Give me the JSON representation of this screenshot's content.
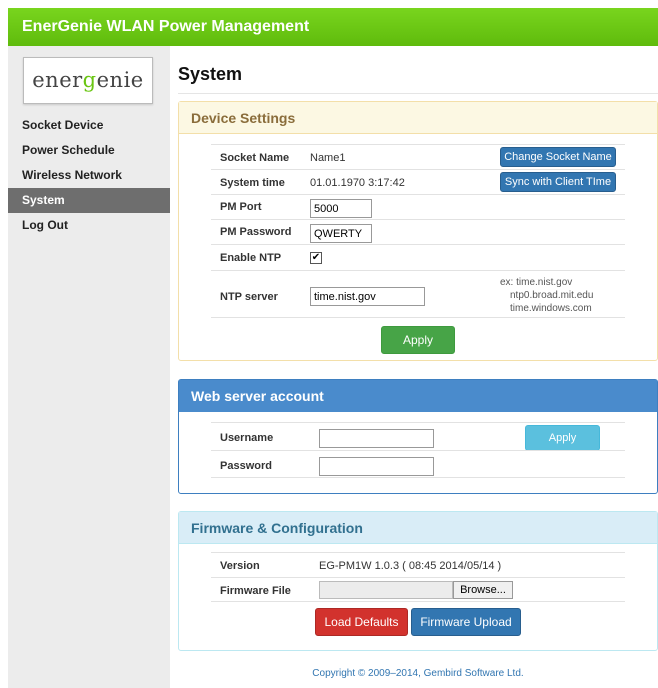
{
  "app": {
    "title": "EnerGenie WLAN Power Management"
  },
  "logo": {
    "part1": "ener",
    "part2": "g",
    "part3": "enie"
  },
  "nav": {
    "items": [
      {
        "label": "Socket Device"
      },
      {
        "label": "Power Schedule"
      },
      {
        "label": "Wireless Network"
      },
      {
        "label": "System"
      },
      {
        "label": "Log Out"
      }
    ],
    "active": "System"
  },
  "page": {
    "title": "System"
  },
  "device_settings": {
    "heading": "Device Settings",
    "socket_name": {
      "label": "Socket Name",
      "value": "Name1",
      "button": "Change Socket Name"
    },
    "system_time": {
      "label": "System time",
      "value": "01.01.1970 3:17:42",
      "button": "Sync with Client TIme"
    },
    "pm_port": {
      "label": "PM Port",
      "value": "5000"
    },
    "pm_password": {
      "label": "PM Password",
      "value": "QWERTY"
    },
    "enable_ntp": {
      "label": "Enable NTP",
      "checked": true,
      "mark": "✔"
    },
    "ntp_server": {
      "label": "NTP server",
      "value": "time.nist.gov",
      "hint_lines": [
        "ex: time.nist.gov",
        "ntp0.broad.mit.edu",
        "time.windows.com"
      ]
    },
    "apply_label": "Apply"
  },
  "web_account": {
    "heading": "Web server account",
    "username": {
      "label": "Username",
      "value": ""
    },
    "password": {
      "label": "Password",
      "value": ""
    },
    "apply_label": "Apply"
  },
  "firmware": {
    "heading": "Firmware & Configuration",
    "version": {
      "label": "Version",
      "value": "EG-PM1W 1.0.3 ( 08:45 2014/05/14 )"
    },
    "file": {
      "label": "Firmware File",
      "browse_label": "Browse..."
    },
    "load_defaults_label": "Load Defaults",
    "upload_label": "Firmware Upload"
  },
  "footer": {
    "copyright": "Copyright © 2009–2014, Gembird Software Ltd."
  },
  "colors": {
    "brand_green": "#6ac613",
    "primary_blue": "#3276b1",
    "success_green": "#47a447",
    "danger_red": "#d2322d",
    "info_light": "#5bc0de"
  }
}
